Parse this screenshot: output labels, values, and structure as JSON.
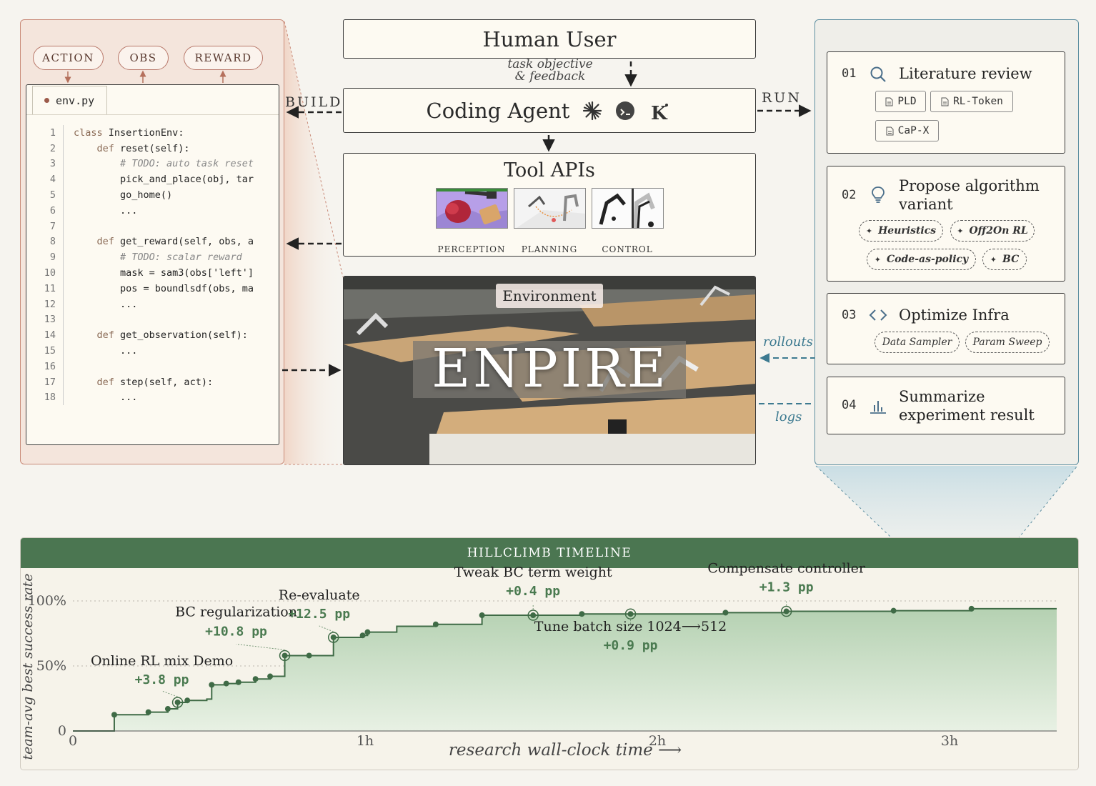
{
  "left_panel": {
    "pills": [
      "ACTION",
      "OBS",
      "REWARD"
    ],
    "file_tab": "env.py",
    "code_lines": [
      {
        "n": "1",
        "parts": [
          [
            "kw",
            "class "
          ],
          [
            "fn",
            "InsertionEnv:"
          ]
        ]
      },
      {
        "n": "2",
        "parts": [
          [
            "kw",
            "    def "
          ],
          [
            "fn",
            "reset(self):"
          ]
        ]
      },
      {
        "n": "3",
        "parts": [
          [
            "cmt",
            "        # TODO: auto task reset"
          ]
        ]
      },
      {
        "n": "4",
        "parts": [
          [
            "fn",
            "        pick_and_place(obj, tar"
          ]
        ]
      },
      {
        "n": "5",
        "parts": [
          [
            "fn",
            "        go_home()"
          ]
        ]
      },
      {
        "n": "6",
        "parts": [
          [
            "fn",
            "        ..."
          ]
        ]
      },
      {
        "n": "7",
        "parts": [
          [
            "fn",
            ""
          ]
        ]
      },
      {
        "n": "8",
        "parts": [
          [
            "kw",
            "    def "
          ],
          [
            "fn",
            "get_reward(self, obs, a"
          ]
        ]
      },
      {
        "n": "9",
        "parts": [
          [
            "cmt",
            "        # TODO: scalar reward"
          ]
        ]
      },
      {
        "n": "10",
        "parts": [
          [
            "fn",
            "        mask = sam3(obs['left']"
          ]
        ]
      },
      {
        "n": "11",
        "parts": [
          [
            "fn",
            "        pos = boundlsdf(obs, ma"
          ]
        ]
      },
      {
        "n": "12",
        "parts": [
          [
            "fn",
            "        ..."
          ]
        ]
      },
      {
        "n": "13",
        "parts": [
          [
            "fn",
            ""
          ]
        ]
      },
      {
        "n": "14",
        "parts": [
          [
            "kw",
            "    def "
          ],
          [
            "fn",
            "get_observation(self):"
          ]
        ]
      },
      {
        "n": "15",
        "parts": [
          [
            "fn",
            "        ..."
          ]
        ]
      },
      {
        "n": "16",
        "parts": [
          [
            "fn",
            ""
          ]
        ]
      },
      {
        "n": "17",
        "parts": [
          [
            "kw",
            "    def "
          ],
          [
            "fn",
            "step(self, act):"
          ]
        ]
      },
      {
        "n": "18",
        "parts": [
          [
            "fn",
            "        ..."
          ]
        ]
      }
    ]
  },
  "middle": {
    "human_user": "Human User",
    "feedback_line1": "task objective",
    "feedback_line2": "& feedback",
    "coding_agent": "Coding Agent",
    "tool_apis": "Tool APIs",
    "tool_labels": [
      "PERCEPTION",
      "PLANNING",
      "CONTROL"
    ],
    "environment_label": "Environment",
    "environment_title": "ENPIRE",
    "build_label": "BUILD",
    "run_label": "RUN",
    "rollouts_label": "rollouts",
    "logs_label": "logs"
  },
  "right_panel": {
    "steps": [
      {
        "num": "01",
        "icon": "search-icon",
        "title_lines": [
          "Literature review"
        ],
        "chips": [
          "PLD",
          "RL-Token",
          "CaP-X"
        ]
      },
      {
        "num": "02",
        "icon": "lightbulb-icon",
        "title_lines": [
          "Propose algorithm",
          "variant"
        ],
        "chips": [
          "Heuristics",
          "Off2On RL",
          "Code-as-policy",
          "BC"
        ]
      },
      {
        "num": "03",
        "icon": "code-icon",
        "title_lines": [
          "Optimize Infra"
        ],
        "chips": [
          "Data Sampler",
          "Param Sweep"
        ]
      },
      {
        "num": "04",
        "icon": "bar-chart-icon",
        "title_lines": [
          "Summarize",
          "experiment result"
        ],
        "chips": []
      }
    ]
  },
  "colors": {
    "build_panel": "#f4e5dc",
    "run_panel_border": "#5c8ea0",
    "timeline_header": "#4b7651",
    "curve": "#3f6b46",
    "fill": "#cfe2cc"
  },
  "chart_data": {
    "type": "area",
    "title": "HILLCLIMB TIMELINE",
    "xlabel": "research wall-clock time ⟶",
    "ylabel": "team-avg best success rate",
    "x_ticks": [
      {
        "v": 0,
        "label": "0"
      },
      {
        "v": 60,
        "label": "1h"
      },
      {
        "v": 120,
        "label": "2h"
      },
      {
        "v": 180,
        "label": "3h"
      }
    ],
    "y_ticks": [
      {
        "v": 0,
        "label": "0"
      },
      {
        "v": 50,
        "label": "50%"
      },
      {
        "v": 100,
        "label": "100%"
      }
    ],
    "xlim": [
      0,
      202
    ],
    "ylim": [
      0,
      100
    ],
    "grid_dotted": true,
    "points": [
      [
        0,
        0
      ],
      [
        8.5,
        0
      ],
      [
        8.5,
        12.5
      ],
      [
        15.5,
        14.5
      ],
      [
        19.5,
        17
      ],
      [
        21.5,
        22
      ],
      [
        23.5,
        23.5
      ],
      [
        27.5,
        24.5
      ],
      [
        28.5,
        25
      ],
      [
        28.5,
        35.5
      ],
      [
        31.5,
        36.5
      ],
      [
        34,
        37.5
      ],
      [
        37.5,
        40
      ],
      [
        40.5,
        42
      ],
      [
        43.5,
        47
      ],
      [
        43.5,
        58
      ],
      [
        48.5,
        58
      ],
      [
        53.5,
        72
      ],
      [
        59.5,
        73.5
      ],
      [
        60.5,
        76
      ],
      [
        66.5,
        80.5
      ],
      [
        74.5,
        80.5
      ],
      [
        74.5,
        82
      ],
      [
        84,
        89
      ],
      [
        94.5,
        89
      ],
      [
        104.5,
        90
      ],
      [
        114.5,
        90
      ],
      [
        134,
        91
      ],
      [
        146.5,
        92
      ],
      [
        168.5,
        92.5
      ],
      [
        184.5,
        94
      ],
      [
        202,
        94
      ]
    ],
    "markers": [
      8.5,
      15.5,
      19.5,
      23.5,
      28.5,
      31.5,
      34,
      37.5,
      40.5,
      48.5,
      59.5,
      60.5,
      74.5,
      84,
      104.5,
      134,
      168.5,
      184.5
    ],
    "annotations": [
      {
        "label": "Online RL mix Demo",
        "delta": "+3.8 pp",
        "x": 21.5,
        "y": 22
      },
      {
        "label": "BC regularization",
        "delta": "+10.8 pp",
        "x": 43.5,
        "y": 58
      },
      {
        "label": "Re-evaluate",
        "delta": "+12.5 pp",
        "x": 53.5,
        "y": 72
      },
      {
        "label": "Tweak BC term weight",
        "delta": "+0.4 pp",
        "x": 94.5,
        "y": 89
      },
      {
        "label": "Tune batch size 1024⟶512",
        "delta": "+0.9 pp",
        "x": 114.5,
        "y": 90
      },
      {
        "label": "Compensate controller",
        "delta": "+1.3 pp",
        "x": 146.5,
        "y": 92
      }
    ]
  }
}
